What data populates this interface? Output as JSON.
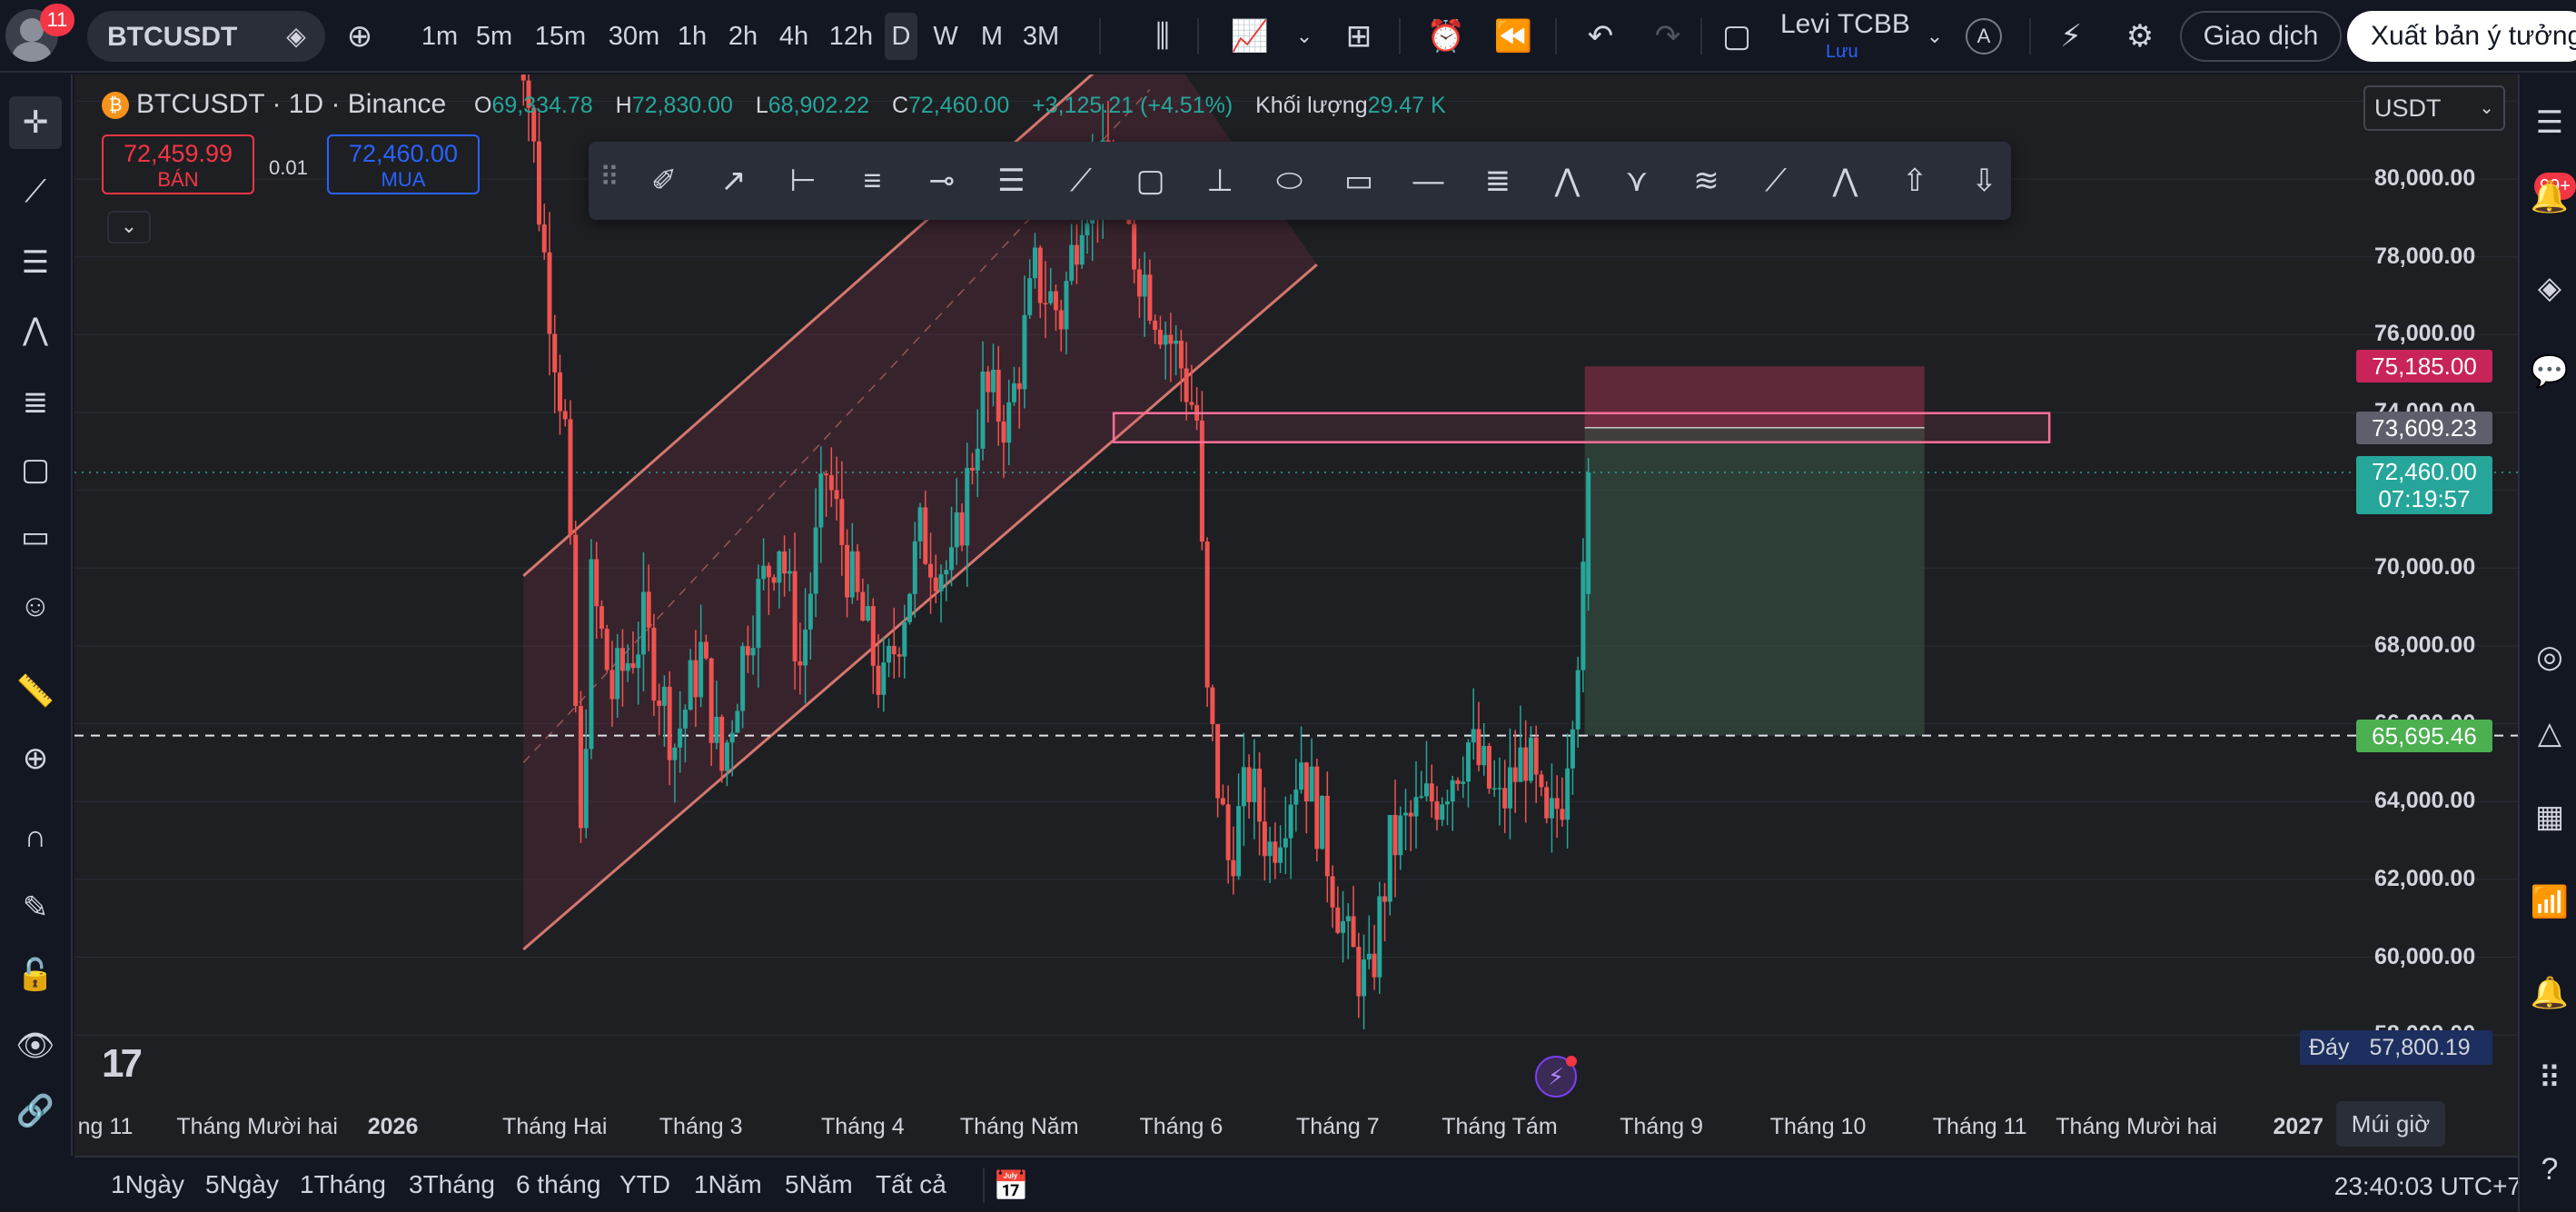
{
  "topbar": {
    "notifications": "11",
    "symbol": "BTCUSDT",
    "intervals": [
      "1m",
      "5m",
      "15m",
      "30m",
      "1h",
      "2h",
      "4h",
      "12h",
      "D",
      "W",
      "M",
      "3M"
    ],
    "active_interval": "D",
    "user_name": "Levi TCBB",
    "user_sub": "Lưu",
    "avatar_letter": "A",
    "trade_label": "Giao dịch",
    "publish_label": "Xuất bản ý tưởng"
  },
  "legend": {
    "title": "BTCUSDT · 1D · Binance",
    "open_key": "O",
    "open": "69,334.78",
    "high_key": "H",
    "high": "72,830.00",
    "low_key": "L",
    "low": "68,902.22",
    "close_key": "C",
    "close": "72,460.00",
    "change": "+3,125.21 (+4.51%)",
    "volume_key": "Khối lượng",
    "volume": "29.47 K"
  },
  "order": {
    "sell_price": "72,459.99",
    "sell_label": "BÁN",
    "spread": "0.01",
    "buy_price": "72,460.00",
    "buy_label": "MUA"
  },
  "currency": "USDT",
  "price_axis": {
    "labels": [
      "80,000.00",
      "78,000.00",
      "76,000.00",
      "74,000.00",
      "70,000.00",
      "68,000.00",
      "66,000.00",
      "64,000.00",
      "62,000.00",
      "60,000.00",
      "58,000.00"
    ],
    "tag_target": "75,185.00",
    "tag_box": "73,609.23",
    "tag_last": "72,460.00",
    "tag_countdown": "07:19:57",
    "tag_stop": "65,695.46",
    "low_key": "Đáy",
    "low_value": "57,800.19"
  },
  "time_axis": {
    "labels": [
      "ng 11",
      "Tháng Mười hai",
      "2026",
      "Tháng Hai",
      "Tháng 3",
      "Tháng 4",
      "Tháng Năm",
      "Tháng 6",
      "Tháng 7",
      "Tháng Tám",
      "Tháng 9",
      "Tháng 10",
      "Tháng 11",
      "Tháng Mười hai",
      "2027"
    ],
    "timezone_btn": "Múi giờ"
  },
  "logo_text": "17",
  "bottom": {
    "ranges": [
      "1Ngày",
      "5Ngày",
      "1Tháng",
      "3Tháng",
      "6 tháng",
      "YTD",
      "1Năm",
      "5Năm",
      "Tất cả"
    ],
    "clock": "23:40:03 UTC+7"
  },
  "sidebar": {
    "badge": "99+"
  },
  "colors": {
    "up": "#26a69a",
    "down": "#ef5350",
    "accent": "#2962ff",
    "bg": "#1e1f23",
    "channel": "#d4776f",
    "target_zone": "#7a2e44",
    "stop_zone": "#33493d"
  },
  "icons": {
    "left": [
      "crosshair-icon",
      "trend-line-icon",
      "horizontal-lines-icon",
      "pattern-icon",
      "fib-icon",
      "rectangle-icon",
      "comment-icon",
      "emoji-icon",
      "ruler-icon",
      "zoom-in-icon",
      "magnet-icon",
      "pencil-lock-icon",
      "lock-icon",
      "eye-icon",
      "link-icon"
    ],
    "right": [
      "list-icon",
      "alerts-icon",
      "layers-icon",
      "chat-icon",
      "gauge-icon",
      "triangle-icon",
      "calendar-icon",
      "broadcast-icon",
      "bell-icon",
      "grid-icon",
      "help-icon"
    ]
  },
  "chart_data": {
    "type": "candlestick",
    "ylim": [
      57000,
      82500
    ],
    "x_start": "2025-11-01",
    "x_end": "2027-01-10",
    "last_candle_date": "2026-08-18",
    "last_close": 72460.0,
    "stop_level": 65695.46,
    "target_level": 75185.0,
    "entry_level": 73609.23,
    "path": [
      [
        "2026-01-24",
        86000
      ],
      [
        "2026-01-30",
        78000
      ],
      [
        "2026-02-03",
        73500
      ],
      [
        "2026-02-06",
        62800
      ],
      [
        "2026-02-08",
        69500
      ],
      [
        "2026-02-12",
        66800
      ],
      [
        "2026-02-18",
        68500
      ],
      [
        "2026-02-24",
        65500
      ],
      [
        "2026-03-01",
        67800
      ],
      [
        "2026-03-05",
        64800
      ],
      [
        "2026-03-10",
        68500
      ],
      [
        "2026-03-16",
        70800
      ],
      [
        "2026-03-20",
        67500
      ],
      [
        "2026-03-25",
        72500
      ],
      [
        "2026-03-30",
        69500
      ],
      [
        "2026-04-05",
        66800
      ],
      [
        "2026-04-12",
        70800
      ],
      [
        "2026-04-18",
        69800
      ],
      [
        "2026-04-24",
        74500
      ],
      [
        "2026-04-29",
        73800
      ],
      [
        "2026-05-04",
        77500
      ],
      [
        "2026-05-09",
        76500
      ],
      [
        "2026-05-13",
        79500
      ],
      [
        "2026-05-18",
        80200
      ],
      [
        "2026-05-22",
        78500
      ],
      [
        "2026-05-27",
        76800
      ],
      [
        "2026-06-01",
        75200
      ],
      [
        "2026-06-04",
        73800
      ],
      [
        "2026-06-06",
        66500
      ],
      [
        "2026-06-10",
        62500
      ],
      [
        "2026-06-14",
        64500
      ],
      [
        "2026-06-18",
        62800
      ],
      [
        "2026-06-24",
        65200
      ],
      [
        "2026-06-28",
        63200
      ],
      [
        "2026-07-03",
        60200
      ],
      [
        "2026-07-07",
        59200
      ],
      [
        "2026-07-11",
        62800
      ],
      [
        "2026-07-15",
        63500
      ],
      [
        "2026-07-20",
        64200
      ],
      [
        "2026-07-26",
        65500
      ],
      [
        "2026-08-01",
        63800
      ],
      [
        "2026-08-06",
        65300
      ],
      [
        "2026-08-10",
        63000
      ],
      [
        "2026-08-13",
        64300
      ],
      [
        "2026-08-15",
        66800
      ],
      [
        "2026-08-17",
        69400
      ],
      [
        "2026-08-18",
        72460
      ]
    ],
    "channel_lower": [
      [
        "2026-01-26",
        60200
      ],
      [
        "2026-06-02",
        73800
      ],
      [
        "2026-06-27",
        77800
      ]
    ],
    "channel_upper": [
      [
        "2026-01-26",
        69800
      ],
      [
        "2026-05-26",
        84000
      ]
    ]
  }
}
